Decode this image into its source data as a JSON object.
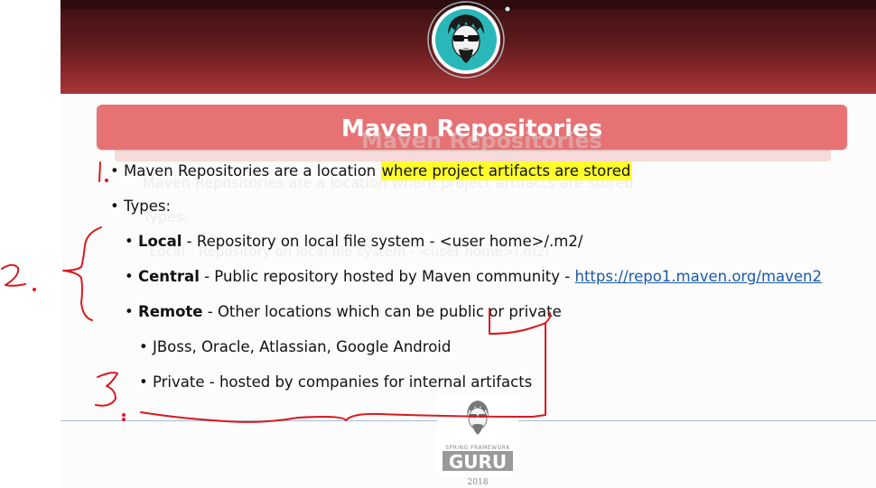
{
  "slide": {
    "title": "Maven Repositories",
    "ghost_title": "Maven Repositories",
    "bullets": {
      "b1_pre": "Maven Repositories are a location ",
      "b1_hl": "where project artifacts are stored",
      "b2": "Types:",
      "local_bold": "Local",
      "local_rest": " - Repository on local file system - <user home>/.m2/",
      "central_bold": "Central",
      "central_rest": " - Public repository hosted by Maven community - ",
      "central_link": "https://repo1.maven.org/maven2",
      "remote_bold": "Remote",
      "remote_rest": " - Other locations which can be public or private",
      "jboss": "JBoss, Oracle, Atlassian, Google Android",
      "private": "Private - hosted by companies for internal artifacts"
    },
    "bullet_char": "•",
    "ghost_lines": {
      "g1": "Maven Repositories are a location where project artifacts are stored",
      "g2": "Types:",
      "g3": "Local - Repository on local file system - <user home>/.m2/"
    }
  },
  "annotations": {
    "n1": "1.",
    "n2": "2.",
    "n3": "3",
    "ink_color": "#d9191f",
    "highlight_color": "#ffff2b"
  },
  "footer": {
    "logo_top": "SPRING FRAMEWORK",
    "logo_main": "GURU",
    "year": "2018"
  },
  "colors": {
    "header_dark": "#3a1012",
    "header_light": "#a73739",
    "title_bar": "#e77274",
    "link": "#1a5aa8",
    "avatar_teal": "#2ab7b9"
  }
}
